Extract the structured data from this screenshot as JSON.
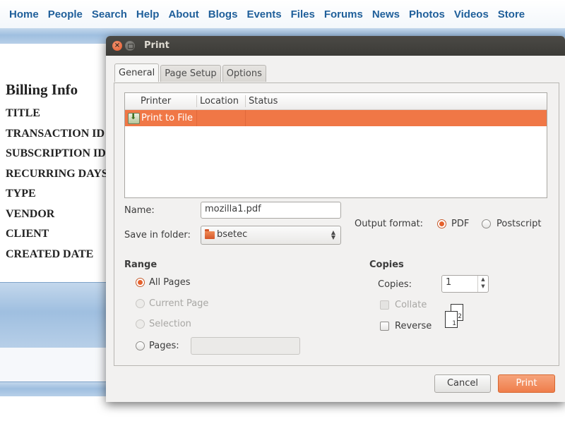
{
  "site_nav": [
    "Home",
    "People",
    "Search",
    "Help",
    "About",
    "Blogs",
    "Events",
    "Files",
    "Forums",
    "News",
    "Photos",
    "Videos",
    "Store"
  ],
  "billing": {
    "title": "Billing Info",
    "labels": [
      "TITLE",
      "TRANSACTION ID",
      "SUBSCRIPTION ID",
      "RECURRING DAYS",
      "TYPE",
      "VENDOR",
      "CLIENT",
      "CREATED DATE"
    ]
  },
  "dialog": {
    "title": "Print",
    "tabs": [
      "General",
      "Page Setup",
      "Options"
    ],
    "printer_list": {
      "columns": [
        "Printer",
        "Location",
        "Status"
      ],
      "rows": [
        {
          "printer": "Print to File",
          "location": "",
          "status": ""
        }
      ]
    },
    "name_label": "Name:",
    "name_value": "mozilla1.pdf",
    "folder_label": "Save in folder:",
    "folder_value": "bsetec",
    "output_format_label": "Output format:",
    "format_options": [
      "PDF",
      "Postscript"
    ],
    "format_selected": "PDF",
    "range_heading": "Range",
    "range_options": [
      "All Pages",
      "Current Page",
      "Selection",
      "Pages:"
    ],
    "range_selected": "All Pages",
    "copies_heading": "Copies",
    "copies_label": "Copies:",
    "copies_value": "1",
    "collate_label": "Collate",
    "reverse_label": "Reverse",
    "collate_icon_pages": [
      "1",
      "2"
    ],
    "cancel_label": "Cancel",
    "print_label": "Print"
  },
  "colors": {
    "accent": "#f07746",
    "link": "#1f5f9a",
    "titlebar": "#3c3b37"
  }
}
